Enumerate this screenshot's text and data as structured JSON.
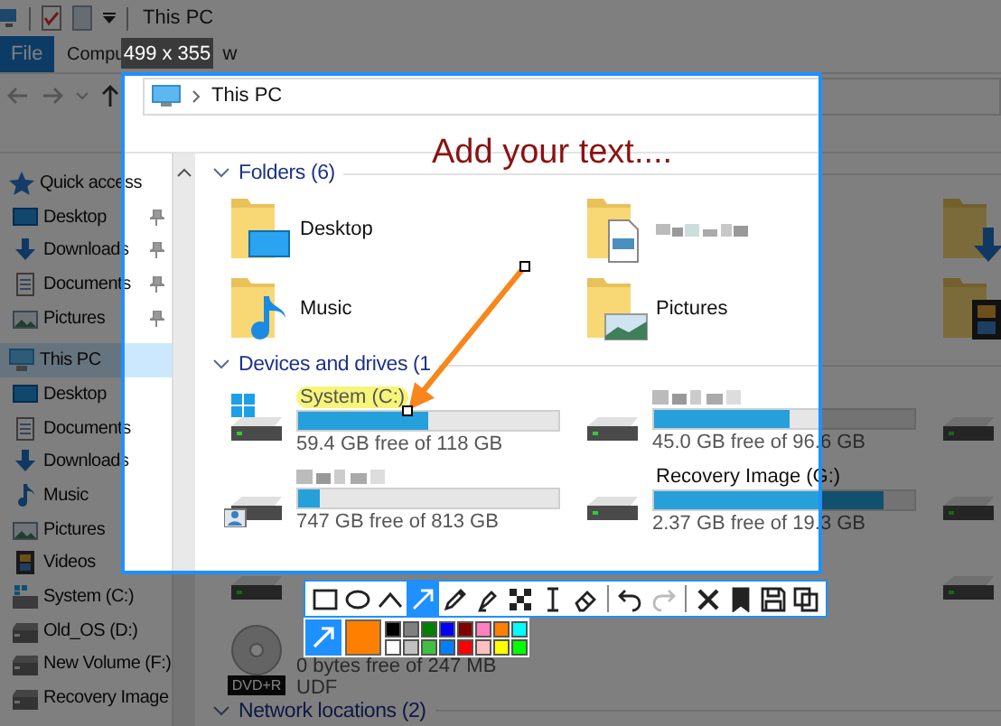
{
  "title_bar": {
    "title": "This PC"
  },
  "ribbon_tabs": [
    {
      "label": "File",
      "selected": true
    },
    {
      "label": "Compu",
      "selected": false
    },
    {
      "label": "w",
      "selected": false
    }
  ],
  "address_bar": {
    "path": "This PC"
  },
  "sidebar": {
    "items": [
      {
        "label": "Quick access",
        "kind": "star",
        "selected": false,
        "pinned": false,
        "children": [
          {
            "label": "Desktop",
            "kind": "desktop",
            "selected": false,
            "pinned": true
          },
          {
            "label": "Downloads",
            "kind": "downloads",
            "selected": false,
            "pinned": true
          },
          {
            "label": "Documents",
            "kind": "documents",
            "selected": false,
            "pinned": true
          },
          {
            "label": "Pictures",
            "kind": "pictures",
            "selected": false,
            "pinned": true
          }
        ]
      },
      {
        "label": "This PC",
        "kind": "pc",
        "selected": true,
        "pinned": false,
        "children": [
          {
            "label": "Desktop",
            "kind": "desktop",
            "selected": false,
            "pinned": false
          },
          {
            "label": "Documents",
            "kind": "documents",
            "selected": false,
            "pinned": false
          },
          {
            "label": "Downloads",
            "kind": "downloads",
            "selected": false,
            "pinned": false
          },
          {
            "label": "Music",
            "kind": "music",
            "selected": false,
            "pinned": false
          },
          {
            "label": "Pictures",
            "kind": "pictures",
            "selected": false,
            "pinned": false
          },
          {
            "label": "Videos",
            "kind": "videos",
            "selected": false,
            "pinned": false
          },
          {
            "label": "System (C:)",
            "kind": "system",
            "selected": false,
            "pinned": false
          },
          {
            "label": "Old_OS (D:)",
            "kind": "drive",
            "selected": false,
            "pinned": false
          },
          {
            "label": "New Volume (F:)",
            "kind": "drive",
            "selected": false,
            "pinned": false
          },
          {
            "label": "Recovery Image",
            "kind": "drive",
            "selected": false,
            "pinned": false
          }
        ]
      }
    ]
  },
  "content": {
    "folders_header": "Folders (6)",
    "folders": [
      {
        "label": "Desktop",
        "kind": "desktop",
        "redacted": false
      },
      {
        "kind": "documents",
        "redacted": true
      },
      {
        "kind": "downloads"
      },
      {
        "label": "Music",
        "kind": "music",
        "redacted": false
      },
      {
        "label": "Pictures",
        "kind": "pictures",
        "redacted": false
      },
      {
        "kind": "videos"
      }
    ],
    "drives_header": "Devices and drives (1",
    "drives": [
      {
        "label": "System (C:)",
        "kind": "windows",
        "redacted": false,
        "highlighted": true,
        "level": 0.5,
        "free": "59.4 GB free of 118 GB"
      },
      {
        "kind": "drive",
        "redacted": true,
        "level": 0.52,
        "free": "45.0 GB free of 96.6 GB"
      },
      {
        "kind": "drive"
      },
      {
        "kind": "user",
        "redacted": true,
        "level": 0.08,
        "free": "747 GB free of 813 GB"
      },
      {
        "label": "Recovery Image (G:)",
        "kind": "drive",
        "redacted": false,
        "highlighted": false,
        "level": 0.88,
        "free": "2.37 GB free of 19.3 GB"
      },
      {
        "kind": "drive"
      },
      {
        "kind": "drive"
      },
      {
        "kind": "blank"
      },
      {
        "kind": "drive"
      },
      {
        "kind": "dvd",
        "badge": "DVD+R",
        "free": "0 bytes free of 247 MB",
        "filesystem": "UDF"
      }
    ],
    "network_header": "Network locations (2)"
  },
  "annotation": {
    "text": "Add your text...."
  },
  "size_badge": "499 x 355",
  "toolbar": {
    "tools": [
      {
        "kind": "rectangle",
        "selected": false,
        "disabled": false
      },
      {
        "kind": "ellipse",
        "selected": false,
        "disabled": false
      },
      {
        "kind": "line",
        "selected": false,
        "disabled": false
      },
      {
        "kind": "arrow",
        "selected": true,
        "disabled": false
      },
      {
        "kind": "pencil",
        "selected": false,
        "disabled": false
      },
      {
        "kind": "marker",
        "selected": false,
        "disabled": false
      },
      {
        "kind": "mosaic",
        "selected": false,
        "disabled": false
      },
      {
        "kind": "text",
        "selected": false,
        "disabled": false
      },
      {
        "kind": "eraser",
        "selected": false,
        "disabled": false
      },
      {
        "kind": "separator"
      },
      {
        "kind": "undo",
        "selected": false,
        "disabled": false
      },
      {
        "kind": "redo",
        "selected": false,
        "disabled": true
      },
      {
        "kind": "separator"
      },
      {
        "kind": "close",
        "selected": false,
        "disabled": false
      },
      {
        "kind": "pin",
        "selected": false,
        "disabled": false
      },
      {
        "kind": "save",
        "selected": false,
        "disabled": false
      },
      {
        "kind": "copy",
        "selected": false,
        "disabled": false
      }
    ],
    "current": {
      "color": "#ff8000"
    },
    "palette": [
      {
        "color": "#000000"
      },
      {
        "color": "#808080"
      },
      {
        "color": "#008000"
      },
      {
        "color": "#0000ff"
      },
      {
        "color": "#800000"
      },
      {
        "color": "#ff80c0"
      },
      {
        "color": "#ff8000"
      },
      {
        "color": "#00ffff"
      },
      {
        "color": "#ffffff"
      },
      {
        "color": "#c0c0c0"
      },
      {
        "color": "#40c040"
      },
      {
        "color": "#0080ff"
      },
      {
        "color": "#ff0000"
      },
      {
        "color": "#ffc0c0"
      },
      {
        "color": "#ffff00"
      },
      {
        "color": "#00ff00"
      }
    ]
  }
}
